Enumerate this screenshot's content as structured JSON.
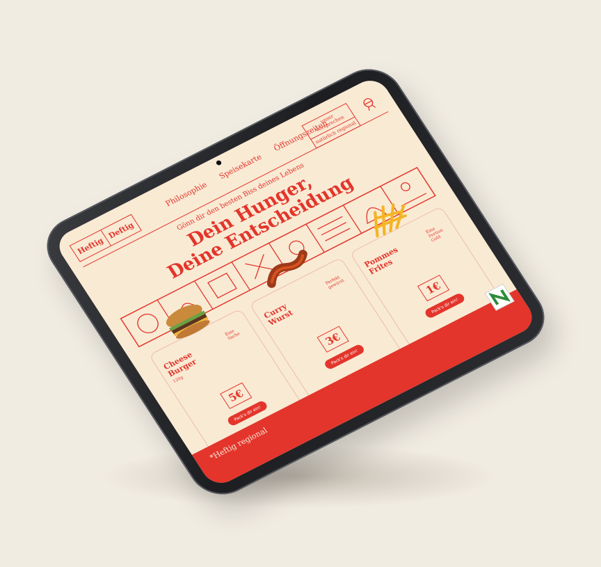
{
  "colors": {
    "accent": "#e3352b",
    "screen_bg": "#f9ead4",
    "page_bg": "#f1ece2"
  },
  "header": {
    "logo_left": "Heftig",
    "logo_right": "Deftig",
    "nav": [
      "Philosophie",
      "Speisekarte",
      "Öffnungszeiten"
    ],
    "promise_box": [
      "unser Versprechen",
      "natürlich regional"
    ],
    "cart_icon": "grill-icon"
  },
  "hero": {
    "tagline": "Gönn dir den besten Biss deines Lebens",
    "headline_line1": "Dein Hunger,",
    "headline_line2": "Deine Entscheidung"
  },
  "products": [
    {
      "name": "Cheese Burger",
      "sub": "Eine Sache",
      "weight": "120g",
      "price": "5€",
      "button": "Pack's dir ein!",
      "image": "burger-image"
    },
    {
      "name": "Curry Wurst",
      "sub": "Perfekt gewürzt",
      "price": "3€",
      "button": "Pack's dir ein!",
      "image": "currywurst-image"
    },
    {
      "name": "Pommes Frites",
      "sub": "Eine Portion Gold",
      "price": "1€",
      "button": "Pack's dir ein!",
      "image": "fries-image"
    }
  ],
  "footer": {
    "title": "*Heftig regional",
    "badge_icon": "regional-badge-icon"
  }
}
